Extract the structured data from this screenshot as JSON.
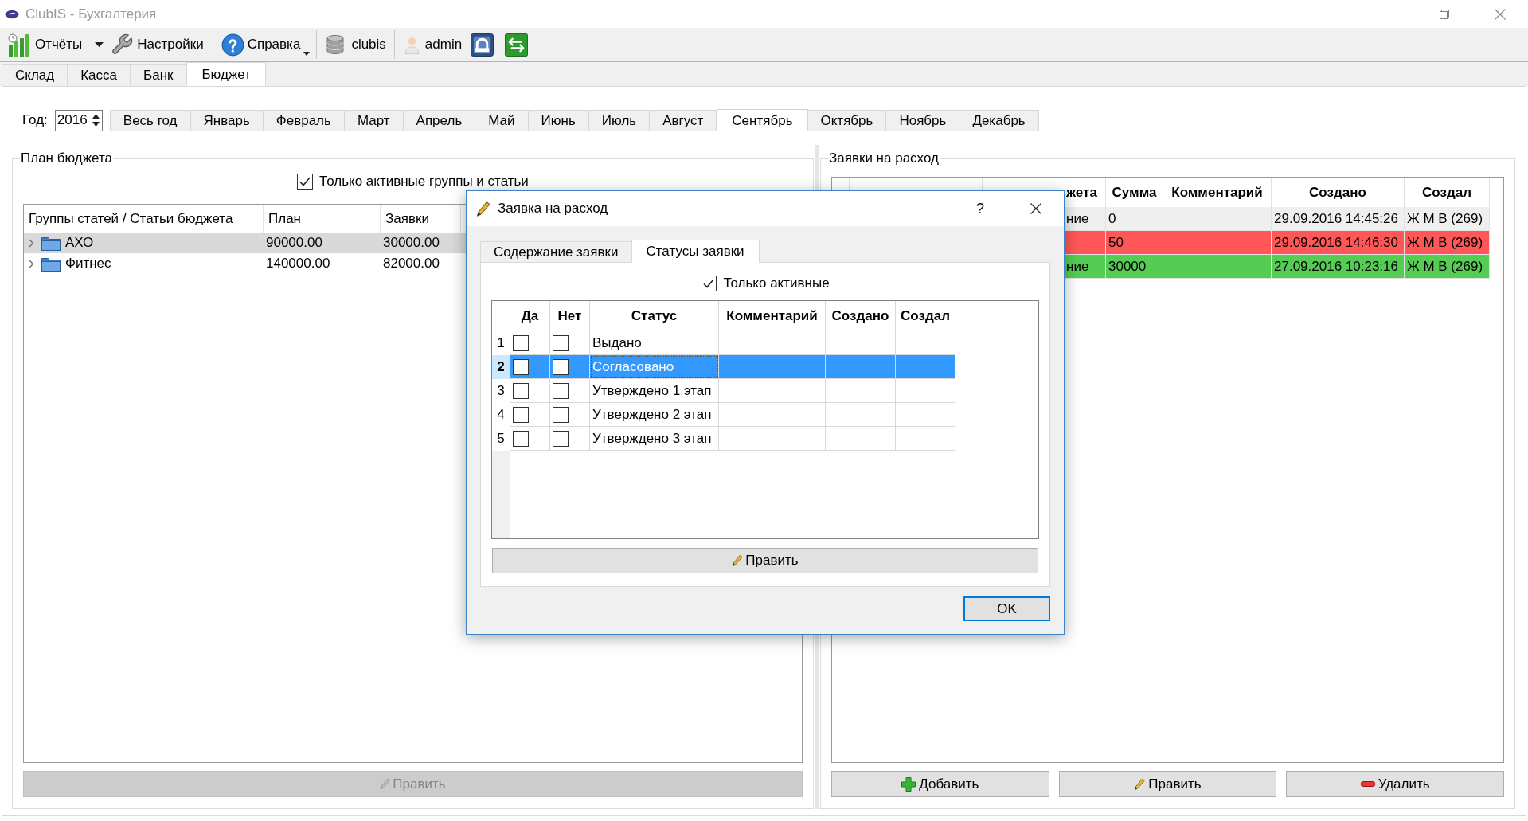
{
  "window": {
    "title": "ClubIS - Бухгалтерия"
  },
  "toolbar": {
    "reports": {
      "label": "Отчёты"
    },
    "settings": {
      "label": "Настройки"
    },
    "help": {
      "label": "Справка"
    },
    "database": {
      "label": "clubis"
    },
    "user": {
      "label": "admin"
    }
  },
  "main_tabs": [
    {
      "label": "Склад",
      "selected": false
    },
    {
      "label": "Касса",
      "selected": false
    },
    {
      "label": "Банк",
      "selected": false
    },
    {
      "label": "Бюджет",
      "selected": true
    }
  ],
  "year": {
    "label": "Год:",
    "value": "2016"
  },
  "months": [
    {
      "label": "Весь год",
      "selected": false
    },
    {
      "label": "Январь",
      "selected": false
    },
    {
      "label": "Февраль",
      "selected": false
    },
    {
      "label": "Март",
      "selected": false
    },
    {
      "label": "Апрель",
      "selected": false
    },
    {
      "label": "Май",
      "selected": false
    },
    {
      "label": "Июнь",
      "selected": false
    },
    {
      "label": "Июль",
      "selected": false
    },
    {
      "label": "Август",
      "selected": false
    },
    {
      "label": "Сентябрь",
      "selected": true
    },
    {
      "label": "Октябрь",
      "selected": false
    },
    {
      "label": "Ноябрь",
      "selected": false
    },
    {
      "label": "Декабрь",
      "selected": false
    }
  ],
  "budget_plan": {
    "title": "План бюджета",
    "active_only": {
      "label": "Только активные группы и статьи",
      "checked": true
    },
    "columns": [
      "Группы статей / Статьи бюджета",
      "План",
      "Заявки"
    ],
    "rows": [
      {
        "name": "АХО",
        "plan": "90000.00",
        "requests": "30000.00",
        "expanded": false,
        "selected": true
      },
      {
        "name": "Фитнес",
        "plan": "140000.00",
        "requests": "82000.00",
        "expanded": false,
        "selected": false
      }
    ],
    "edit_button": {
      "label": "Править",
      "disabled": true
    }
  },
  "expense_requests": {
    "title": "Заявки на расход",
    "columns": {
      "column_3": "жета",
      "sum": "Сумма",
      "comment": "Комментарий",
      "created": "Создано",
      "created_by": "Создал"
    },
    "rows": [
      {
        "color": "#efefef",
        "column_3": "ние",
        "sum": "0",
        "created": "29.09.2016 14:45:26",
        "created_by": "Ж М В (269)"
      },
      {
        "color": "#ff5757",
        "sum": "50",
        "created": "29.09.2016 14:46:30",
        "created_by": "Ж М В (269)"
      },
      {
        "color": "#55cd55",
        "column_3": "ние",
        "sum": "30000",
        "created": "27.09.2016 10:23:16",
        "created_by": "Ж М В (269)"
      }
    ],
    "buttons": [
      {
        "kind": "add",
        "label": "Добавить"
      },
      {
        "kind": "edit",
        "label": "Править"
      },
      {
        "kind": "delete",
        "label": "Удалить"
      }
    ]
  },
  "dialog": {
    "title": "Заявка на расход",
    "help": "?",
    "tabs": [
      {
        "label": "Содержание заявки",
        "selected": false
      },
      {
        "label": "Статусы заявки",
        "selected": true
      }
    ],
    "active_only": {
      "label": "Только активные",
      "checked": true
    },
    "columns": {
      "yes": "Да",
      "no": "Нет",
      "status": "Статус",
      "comment": "Комментарий",
      "created": "Создано",
      "created_by": "Создал"
    },
    "rows": [
      {
        "number": "1",
        "yes": false,
        "no": false,
        "status": "Выдано",
        "selected": false
      },
      {
        "number": "2",
        "yes": false,
        "no": false,
        "status": "Согласовано",
        "selected": true
      },
      {
        "number": "3",
        "yes": false,
        "no": false,
        "status": "Утверждено 1 этап",
        "selected": false
      },
      {
        "number": "4",
        "yes": false,
        "no": false,
        "status": "Утверждено 2 этап",
        "selected": false
      },
      {
        "number": "5",
        "yes": false,
        "no": false,
        "status": "Утверждено 3 этап",
        "selected": false
      }
    ],
    "edit_button": {
      "label": "Править"
    },
    "ok_button": {
      "label": "OK",
      "default": true
    }
  }
}
